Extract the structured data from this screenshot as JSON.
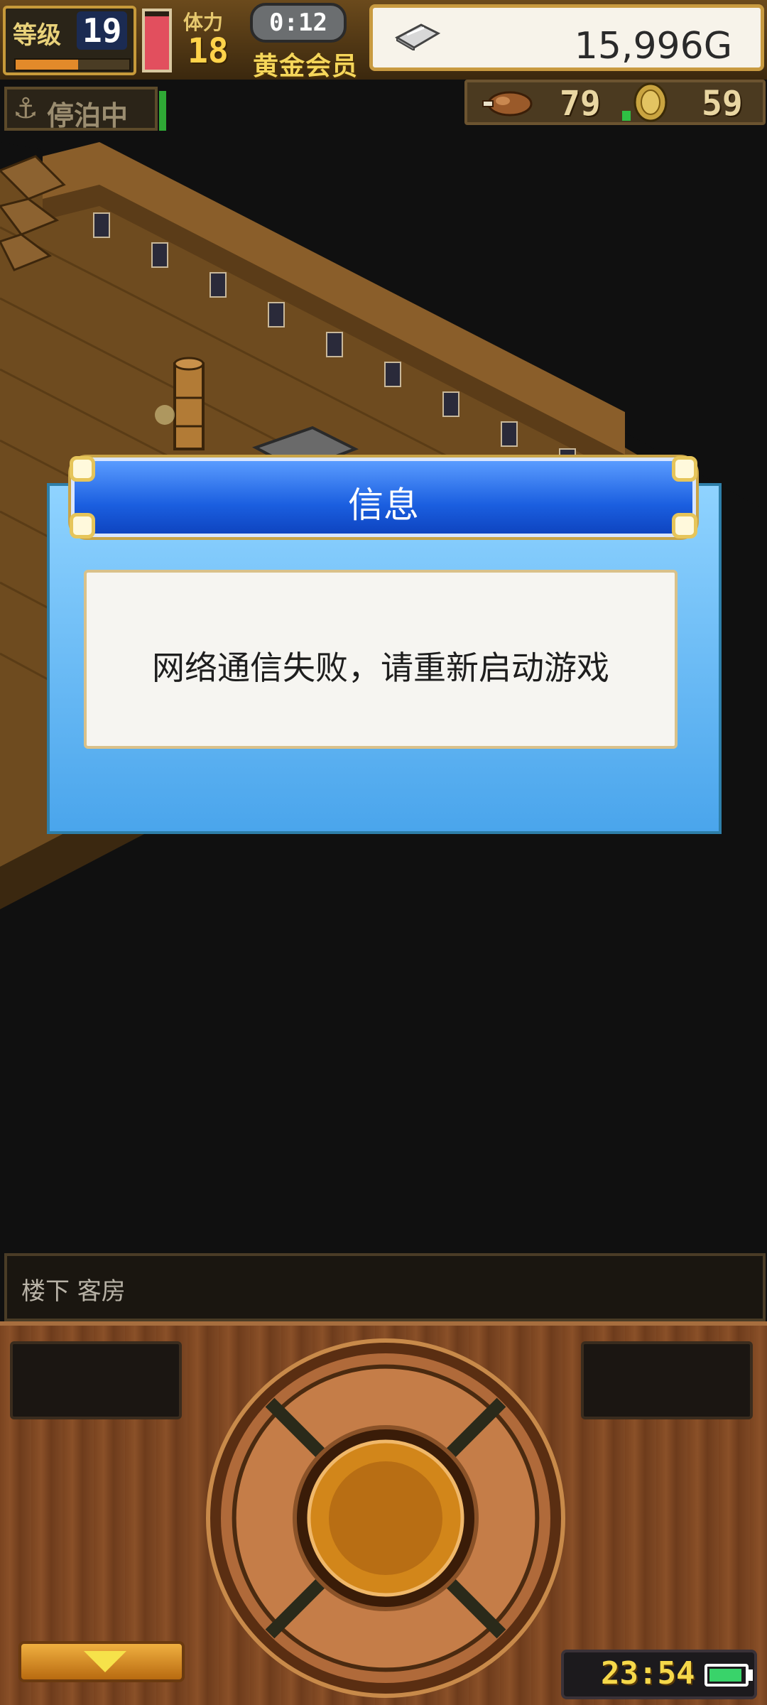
{
  "hud": {
    "level_label": "等级",
    "level": "19",
    "xp_progress": 0.55,
    "stamina_level": 0.92,
    "physical_label": "体力",
    "physical": "18",
    "timer": "0:12",
    "membership": "黄金会员",
    "money": "15,996G",
    "status": "停泊中",
    "food": "79",
    "coins": "59"
  },
  "dialog": {
    "title": "信息",
    "message": "网络通信失败，请重新启动游戏"
  },
  "location": {
    "text": "楼下 客房"
  },
  "controls": {
    "clock": "23:54",
    "battery_level": 0.95
  },
  "colors": {
    "dialog_header": "#1b5fe0",
    "dialog_bg": "#4aa5ec",
    "deck_wood": "#6b4a1e",
    "gold_text": "#f5d65a"
  },
  "icons": [
    "silver-ingot-icon",
    "anchor-icon",
    "roast-meat-icon",
    "gold-coin-icon",
    "down-arrow-icon",
    "battery-icon"
  ]
}
